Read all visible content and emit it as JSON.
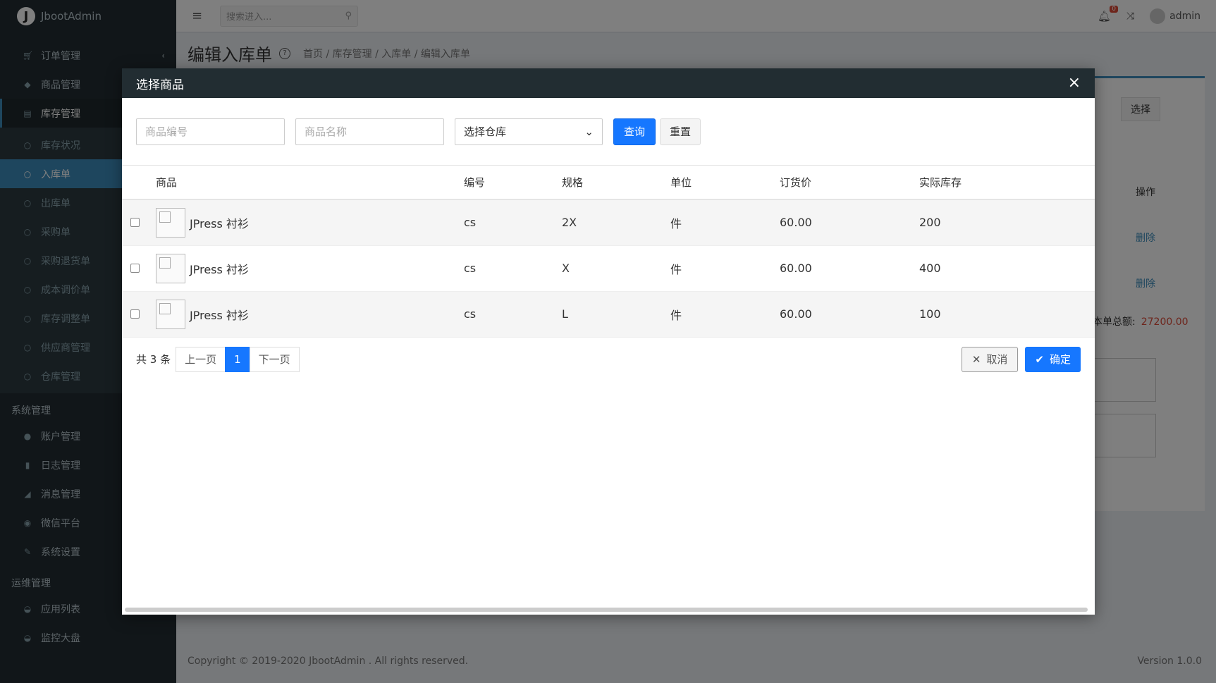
{
  "app": {
    "brand": "JbootAdmin",
    "logo_letter": "J"
  },
  "sidebar": {
    "top_items": [
      {
        "label": "订单管理",
        "icon": "cart-icon"
      },
      {
        "label": "商品管理",
        "icon": "tag-icon"
      },
      {
        "label": "库存管理",
        "icon": "warehouse-icon"
      }
    ],
    "sub_items": [
      {
        "label": "库存状况"
      },
      {
        "label": "入库单"
      },
      {
        "label": "出库单"
      },
      {
        "label": "采购单"
      },
      {
        "label": "采购退货单"
      },
      {
        "label": "成本调价单"
      },
      {
        "label": "库存调整单"
      },
      {
        "label": "供应商管理"
      },
      {
        "label": "仓库管理"
      }
    ],
    "system_header": "系统管理",
    "system_items": [
      {
        "label": "账户管理"
      },
      {
        "label": "日志管理"
      },
      {
        "label": "消息管理"
      },
      {
        "label": "微信平台"
      },
      {
        "label": "系统设置"
      }
    ],
    "ops_header": "运维管理",
    "ops_items": [
      {
        "label": "应用列表"
      },
      {
        "label": "监控大盘"
      }
    ]
  },
  "topbar": {
    "search_placeholder": "搜索进入...",
    "notification_count": "0",
    "username": "admin"
  },
  "page": {
    "title": "编辑入库单",
    "breadcrumb": [
      "首页",
      "库存管理",
      "入库单",
      "编辑入库单"
    ],
    "bg_select_label": "选择",
    "bg_col_action": "操作",
    "bg_delete_label": "删除",
    "bg_total_label": "本单总额:",
    "bg_total_value": "27200.00"
  },
  "footer": {
    "copyright": "Copyright © 2019-2020 JbootAdmin . All rights reserved.",
    "version": "Version 1.0.0"
  },
  "modal": {
    "title": "选择商品",
    "filters": {
      "code_placeholder": "商品编号",
      "name_placeholder": "商品名称",
      "warehouse_selected": "选择仓库",
      "query_label": "查询",
      "reset_label": "重置"
    },
    "columns": [
      "商品",
      "编号",
      "规格",
      "单位",
      "订货价",
      "实际库存"
    ],
    "rows": [
      {
        "name": "JPress 衬衫",
        "code": "cs",
        "spec": "2X",
        "unit": "件",
        "price": "60.00",
        "stock": "200"
      },
      {
        "name": "JPress 衬衫",
        "code": "cs",
        "spec": "X",
        "unit": "件",
        "price": "60.00",
        "stock": "400"
      },
      {
        "name": "JPress 衬衫",
        "code": "cs",
        "spec": "L",
        "unit": "件",
        "price": "60.00",
        "stock": "100"
      }
    ],
    "pager": {
      "total_text": "共 3 条",
      "prev": "上一页",
      "current": "1",
      "next": "下一页"
    },
    "cancel_label": "取消",
    "ok_label": "确定"
  }
}
